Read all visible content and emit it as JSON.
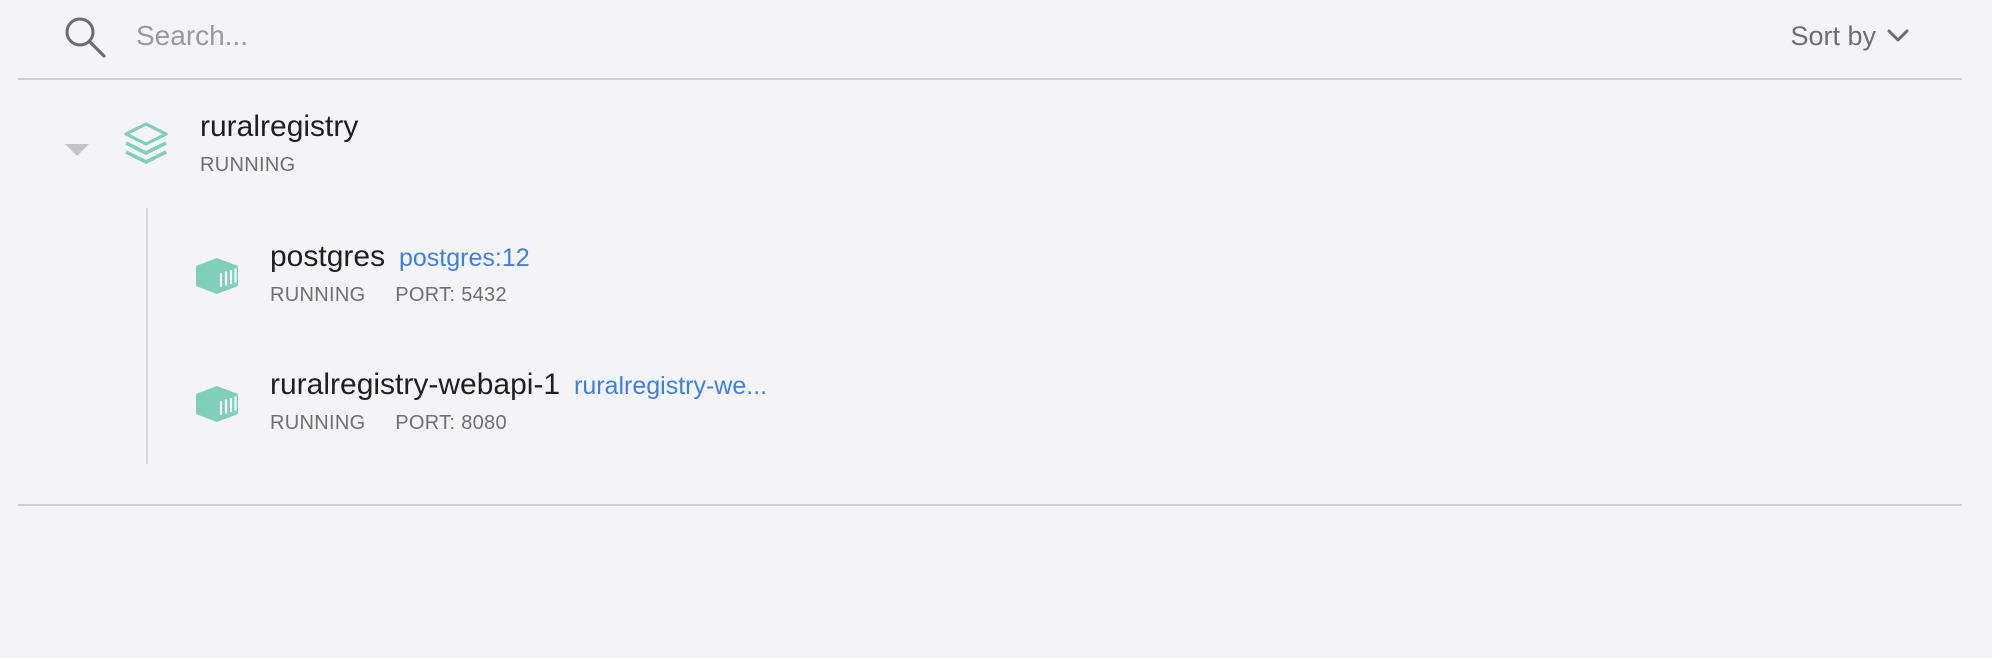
{
  "search": {
    "placeholder": "Search...",
    "value": ""
  },
  "sort": {
    "label": "Sort by"
  },
  "colors": {
    "accent_teal": "#7fd0b6",
    "link_blue": "#3e7fe0",
    "muted_text": "#6f6f6f"
  },
  "app": {
    "name": "ruralregistry",
    "status": "RUNNING",
    "icon": "stack-icon",
    "containers": [
      {
        "name": "postgres",
        "image": "postgres:12",
        "status": "RUNNING",
        "port": "PORT: 5432",
        "icon": "container-icon"
      },
      {
        "name": "ruralregistry-webapi-1",
        "image": "ruralregistry-we...",
        "status": "RUNNING",
        "port": "PORT: 8080",
        "icon": "container-icon"
      }
    ]
  }
}
